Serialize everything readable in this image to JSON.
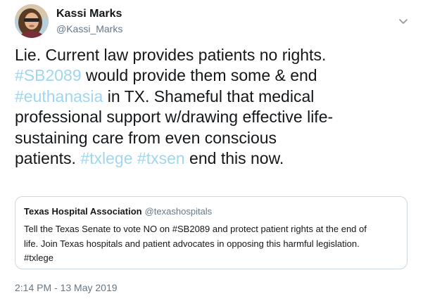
{
  "author": {
    "display_name": "Kassi Marks",
    "handle": "@Kassi_Marks"
  },
  "tweet": {
    "lines": [
      [
        {
          "text": "Lie. Current law provides patients no rights.",
          "type": "text"
        }
      ],
      [
        {
          "text": "#SB2089",
          "type": "hashtag"
        },
        {
          "text": " would provide them some & end",
          "type": "text"
        }
      ],
      [
        {
          "text": "#euthanasia",
          "type": "hashtag"
        },
        {
          "text": " in TX. Shameful that medical",
          "type": "text"
        }
      ],
      [
        {
          "text": "professional support w/drawing effective life-",
          "type": "text"
        }
      ],
      [
        {
          "text": "sustaining care from even conscious",
          "type": "text"
        }
      ],
      [
        {
          "text": "patients. ",
          "type": "text"
        },
        {
          "text": "#txlege",
          "type": "hashtag"
        },
        {
          "text": " ",
          "type": "text"
        },
        {
          "text": "#txsen",
          "type": "hashtag"
        },
        {
          "text": " end this now.",
          "type": "text"
        }
      ]
    ]
  },
  "quoted_tweet": {
    "display_name": "Texas Hospital Association",
    "handle": "@texashospitals",
    "lines": [
      "Tell the Texas Senate to vote NO on #SB2089 and protect patient rights at the end of",
      "life. Join Texas hospitals and patient advocates in opposing this harmful legislation.",
      "#txlege"
    ]
  },
  "timestamp": "2:14 PM - 13 May 2019",
  "colors": {
    "hashtag": "#9fd6f0",
    "secondary_text": "#657786",
    "border": "#ccd6dd"
  },
  "icons": {
    "caret": "chevron-down-icon",
    "avatar": "profile-photo"
  }
}
